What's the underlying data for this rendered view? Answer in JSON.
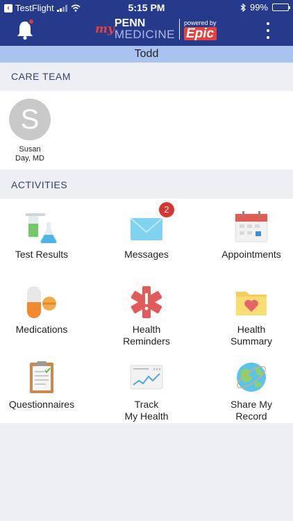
{
  "status_bar": {
    "carrier": "TestFlight",
    "time": "5:15 PM",
    "battery": "99%",
    "battery_level": 0.99
  },
  "header": {
    "logo_my": "my",
    "logo_penn": "PENN",
    "logo_medicine": "MEDICINE",
    "powered_by": "powered by",
    "epic": "Epic"
  },
  "patient": {
    "name": "Todd"
  },
  "care_team": {
    "title": "CARE TEAM",
    "providers": [
      {
        "initial": "S",
        "name_line1": "Susan",
        "name_line2": "Day, MD"
      }
    ]
  },
  "activities": {
    "title": "ACTIVITIES",
    "items": [
      {
        "line1": "Test Results",
        "line2": ""
      },
      {
        "line1": "Messages",
        "line2": "",
        "badge": "2"
      },
      {
        "line1": "Appointments",
        "line2": ""
      },
      {
        "line1": "Medications",
        "line2": ""
      },
      {
        "line1": "Health",
        "line2": "Reminders"
      },
      {
        "line1": "Health",
        "line2": "Summary"
      },
      {
        "line1": "Questionnaires",
        "line2": ""
      },
      {
        "line1": "Track",
        "line2": "My Health"
      },
      {
        "line1": "Share My",
        "line2": "Record"
      }
    ]
  },
  "colors": {
    "header_bg": "#263a8c",
    "patient_bar": "#a9c3f1",
    "badge": "#d9352e",
    "page_bg": "#eeeef5"
  }
}
